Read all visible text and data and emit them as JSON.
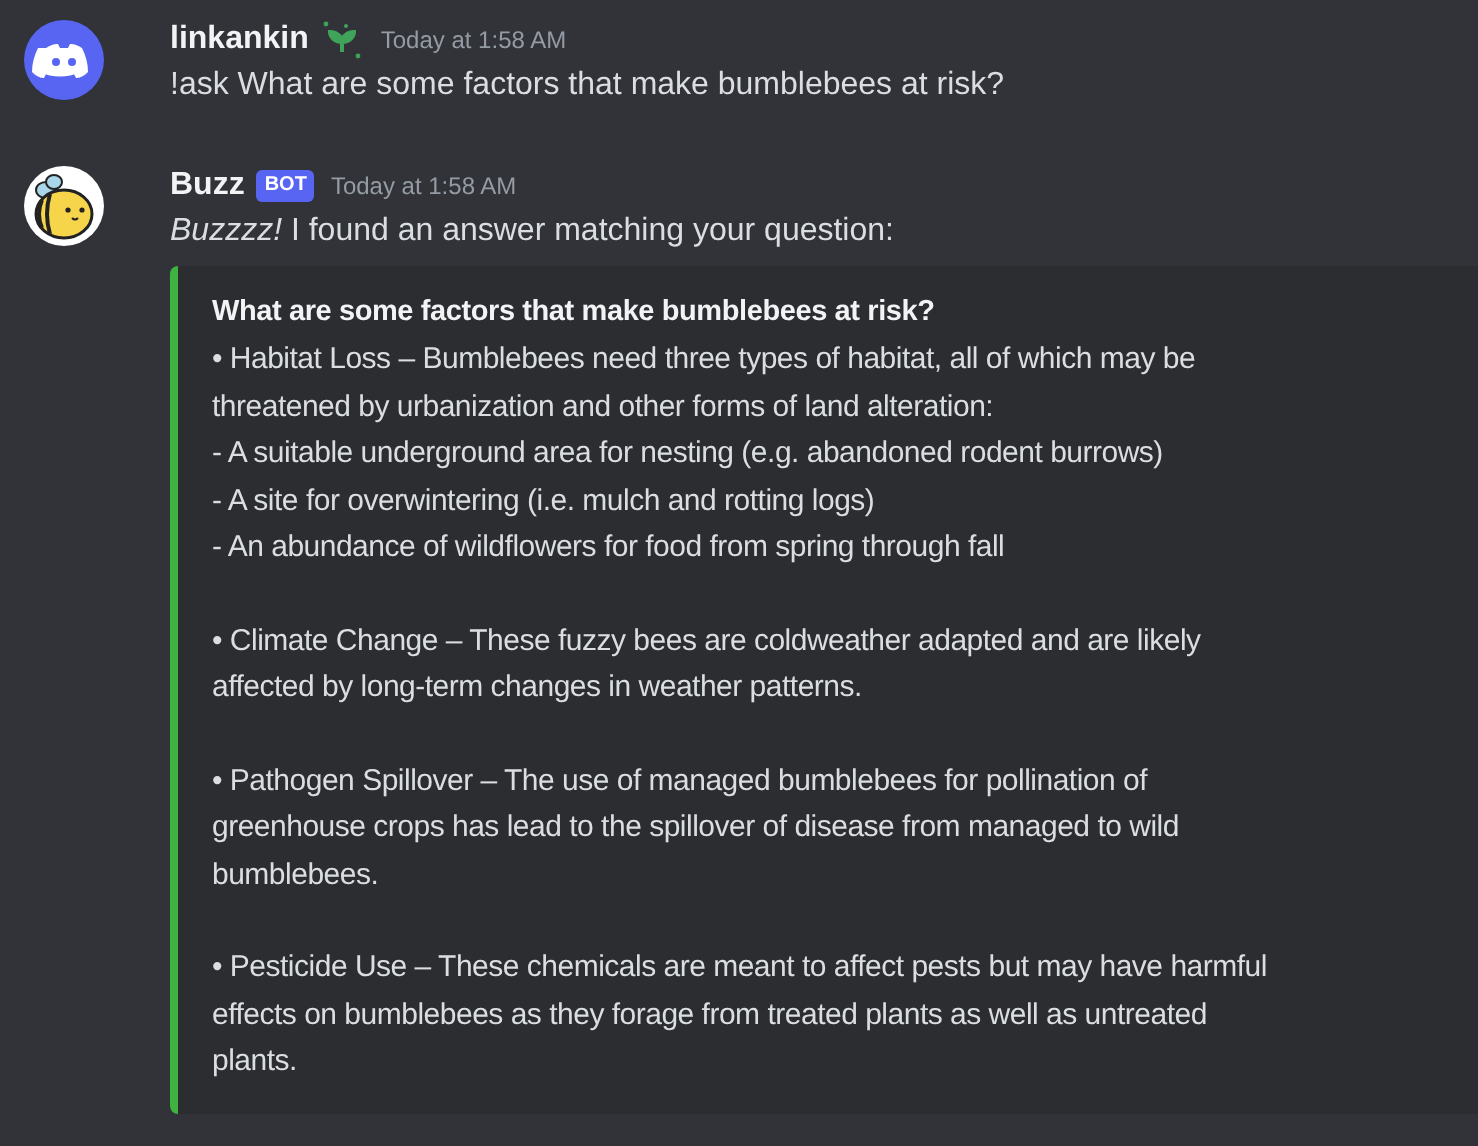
{
  "messages": [
    {
      "kind": "user",
      "author": "linkankin",
      "time": "Today at 1:58 AM",
      "text": "!ask What are some factors that make bumblebees at risk?"
    },
    {
      "kind": "bot",
      "author": "Buzz",
      "badge": "BOT",
      "time": "Today at 1:58 AM",
      "text": "*Buzzzz!* I found an answer matching your question:",
      "embed": {
        "color": "#3fb33f",
        "title": "What are some factors that make bumblebees at risk?",
        "paragraphs": [
          [
            "• Habitat Loss – Bumblebees need three types of habitat, all of which may be",
            "threatened by urbanization and other forms of land alteration:",
            "- A suitable underground area for nesting (e.g. abandoned rodent burrows)",
            "- A site for overwintering (i.e. mulch and rotting logs)",
            "- An abundance of wildflowers for food from spring through fall"
          ],
          [
            "• Climate Change – These fuzzy bees are coldweather adapted and are likely",
            "affected by long-term changes in weather patterns."
          ],
          [
            "• Pathogen Spillover – The use of managed bumblebees for pollination of",
            "greenhouse crops has lead to the spillover of disease from managed to wild",
            "bumblebees."
          ],
          [
            "• Pesticide Use – These chemicals are meant to affect pests but may have harmful",
            "effects on bumblebees as they forage from treated plants as well as untreated",
            "plants."
          ]
        ]
      }
    }
  ]
}
